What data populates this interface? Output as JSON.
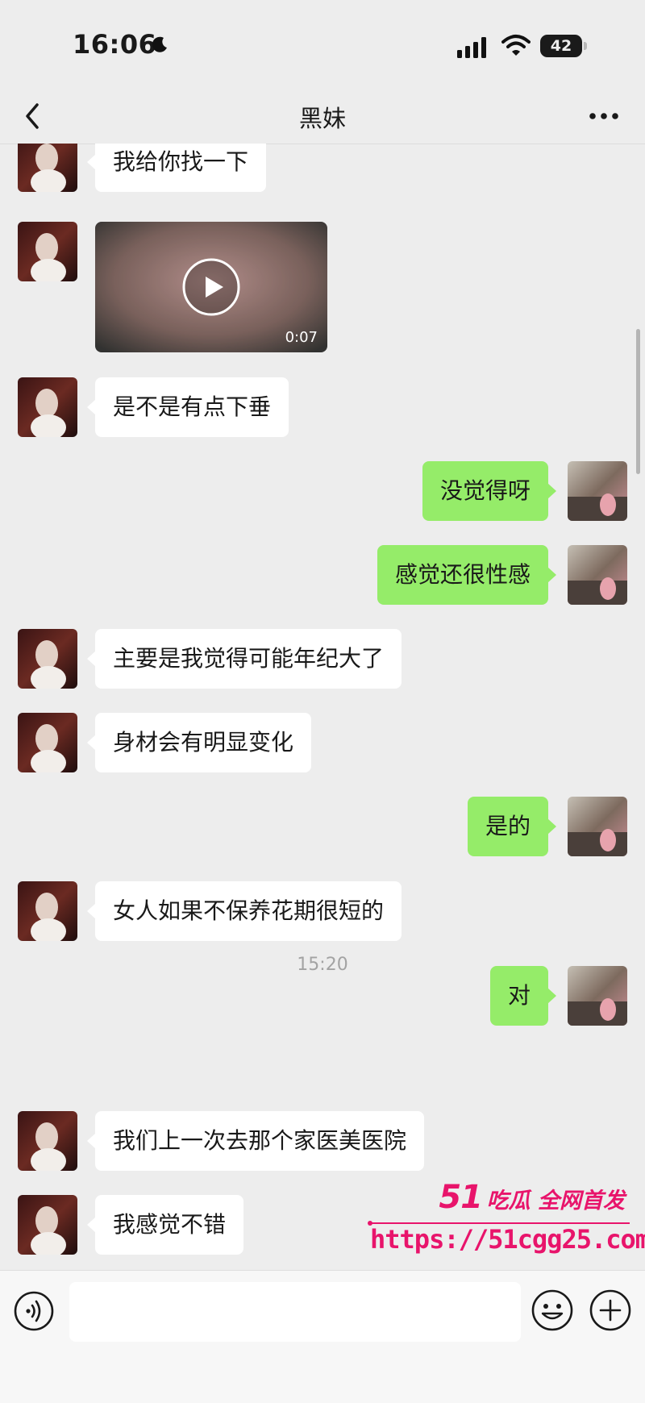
{
  "status_bar": {
    "time": "16:06",
    "battery": "42"
  },
  "header": {
    "title": "黑妹"
  },
  "messages": [
    {
      "side": "in",
      "type": "text",
      "text": "我给你找一下"
    },
    {
      "side": "in",
      "type": "video",
      "duration": "0:07"
    },
    {
      "side": "in",
      "type": "text",
      "text": "是不是有点下垂"
    },
    {
      "side": "out",
      "type": "text",
      "text": "没觉得呀"
    },
    {
      "side": "out",
      "type": "text",
      "text": "感觉还很性感"
    },
    {
      "side": "in",
      "type": "text",
      "text": "主要是我觉得可能年纪大了"
    },
    {
      "side": "in",
      "type": "text",
      "text": "身材会有明显变化"
    },
    {
      "side": "out",
      "type": "text",
      "text": "是的"
    },
    {
      "side": "in",
      "type": "text",
      "text": "女人如果不保养花期很短的"
    },
    {
      "side": "out",
      "type": "text",
      "text": "对"
    },
    {
      "type": "time",
      "text": "15:20"
    },
    {
      "side": "in",
      "type": "text",
      "text": "我们上一次去那个家医美医院"
    },
    {
      "side": "in",
      "type": "text",
      "text": "我感觉不错"
    }
  ],
  "watermark": {
    "number": "51",
    "brand": "吃瓜 全网首发",
    "url": "https://51cgg25.com",
    "color": "#e8146b"
  },
  "icons": {
    "back": "chevron-left-icon",
    "more": "more-dots-icon",
    "voice": "voice-icon",
    "emoji": "emoji-icon",
    "add": "plus-icon",
    "play": "play-icon"
  },
  "colors": {
    "background": "#ededed",
    "outgoing_bubble": "#95ec69",
    "incoming_bubble": "#ffffff"
  }
}
